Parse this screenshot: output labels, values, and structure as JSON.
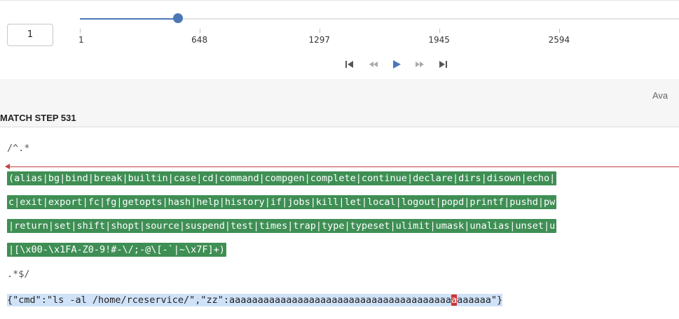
{
  "step_input": {
    "value": "1"
  },
  "slider": {
    "min": 1,
    "max": 3243,
    "current_step": 531,
    "tick_labels": [
      "1",
      "648",
      "1297",
      "1945",
      "2594"
    ],
    "accent_color": "#4a78b5"
  },
  "playback": {
    "controls": [
      "skip-first-icon",
      "step-back-icon",
      "play-icon",
      "step-forward-icon",
      "skip-last-icon"
    ]
  },
  "header": {
    "avail_label": "Ava",
    "match_title": "MATCH STEP 531"
  },
  "regex": {
    "open_line": "/^.*",
    "highlight_lines": [
      "(alias|bg|bind|break|builtin|case|cd|command|compgen|complete|continue|declare|dirs|disown|echo|",
      "c|exit|export|fc|fg|getopts|hash|help|history|if|jobs|kill|let|local|logout|popd|printf|pushd|pw",
      "|return|set|shift|shopt|source|suspend|test|times|trap|type|typeset|ulimit|umask|unalias|unset|u",
      "|[\\x00-\\x1FA-Z0-9!#-\\/;-@\\[-`|~\\x7F]+)"
    ],
    "close_line": ".*$/",
    "highlight_color": "#3f8f55"
  },
  "subject": {
    "before_cursor": "{\"cmd\":\"ls -al /home/rceservice/\",\"zz\":aaaaaaaaaaaaaaaaaaaaaaaaaaaaaaaaaaaaaaa",
    "cursor_char": "a",
    "after_cursor": "aaaaaa\"}",
    "cursor_color": "#d03131",
    "background_color": "#cfe2f8"
  }
}
